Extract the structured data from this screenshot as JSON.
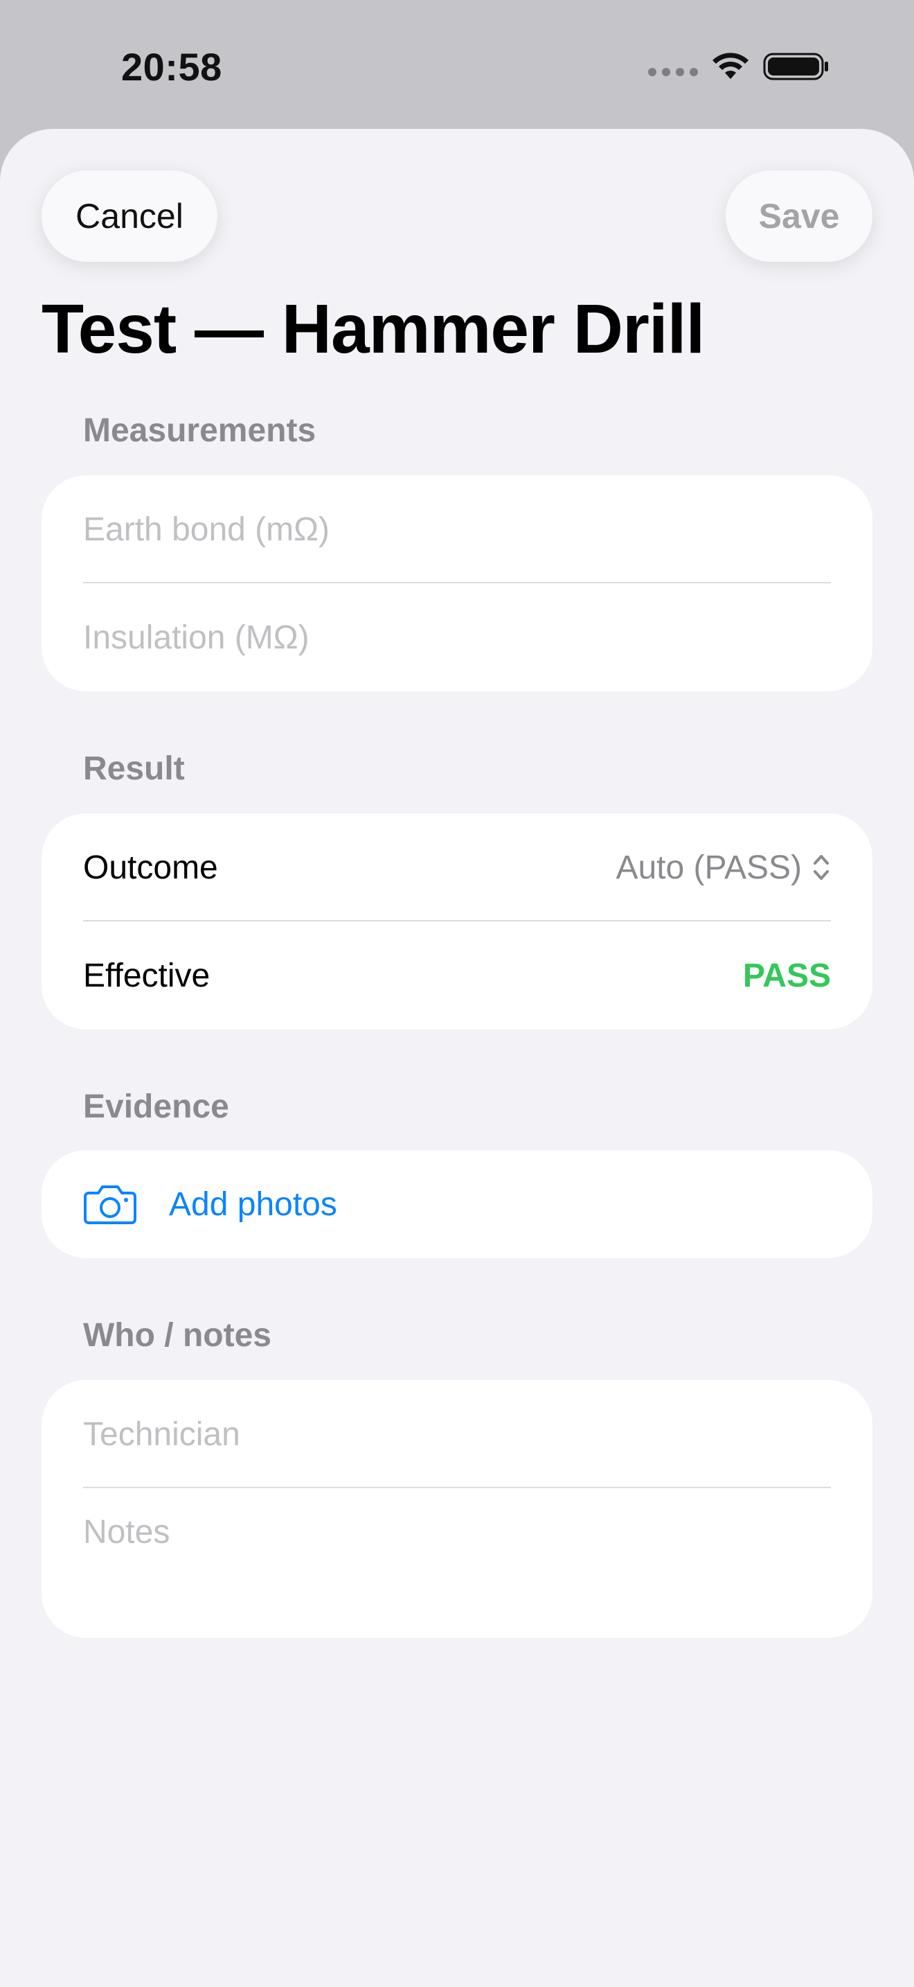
{
  "status_bar": {
    "time": "20:58"
  },
  "toolbar": {
    "cancel_label": "Cancel",
    "save_label": "Save"
  },
  "page": {
    "title": "Test — Hammer Drill"
  },
  "sections": {
    "measurements": {
      "header": "Measurements",
      "earth_bond_placeholder": "Earth bond (mΩ)",
      "insulation_placeholder": "Insulation (MΩ)"
    },
    "result": {
      "header": "Result",
      "outcome_label": "Outcome",
      "outcome_value": "Auto (PASS)",
      "effective_label": "Effective",
      "effective_value": "PASS"
    },
    "evidence": {
      "header": "Evidence",
      "add_photos_label": "Add photos",
      "icon": "camera-icon"
    },
    "who_notes": {
      "header": "Who / notes",
      "technician_placeholder": "Technician",
      "notes_placeholder": "Notes"
    }
  },
  "colors": {
    "accent": "#0a84ff",
    "pass": "#34c759",
    "background": "#f2f2f7",
    "secondary_text": "#8a8a8e"
  }
}
